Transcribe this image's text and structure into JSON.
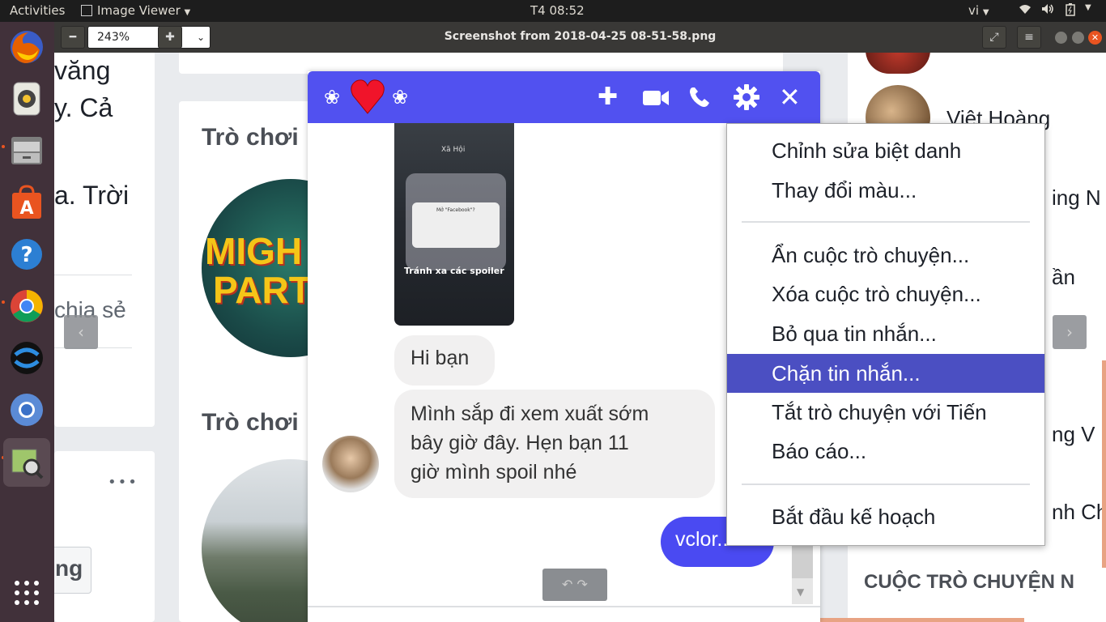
{
  "topbar": {
    "activities": "Activities",
    "app_name": "Image Viewer",
    "clock": "T4 08:52",
    "lang": "vi"
  },
  "launcher": {
    "apps": [
      "firefox-icon",
      "rhythmbox-icon",
      "files-icon",
      "software-center-icon",
      "help-icon",
      "chrome-icon",
      "sync-icon",
      "chromium-icon",
      "image-viewer-icon",
      "app-grid-icon"
    ]
  },
  "viewer": {
    "zoom": "243%",
    "title": "Screenshot from 2018-04-25 08-51-58.png"
  },
  "background_page": {
    "left_text_1": "văng",
    "left_text_2": "y. Cả",
    "left_text_3": "a. Trời",
    "share_text": "chia sẻ",
    "more_dots": "•••",
    "partial_button": "ng",
    "game_heading_1": "Trò chơi",
    "game_heading_2": "Trò chơi",
    "game_logo_line1": "MIGH",
    "game_logo_line2": "PART",
    "contacts": [
      "Việt Hoàng",
      "ing N",
      "ần",
      "ng V",
      "nh Ch"
    ],
    "conversations_heading": "CUỘC TRÒ CHUYỆN N"
  },
  "chat": {
    "shared_image_line1": "Xã Hội",
    "shared_image_line2": "Mở \"Facebook\"?",
    "shared_image_line3": "Tránh xa các spoiler",
    "messages": [
      {
        "text": "Hi bạn"
      },
      {
        "text_lines": [
          "Mình sắp đi xem xuất sớm",
          "bây giờ đây. Hẹn bạn 11",
          "giờ mình spoil nhé"
        ]
      }
    ],
    "outgoing": "vclor..."
  },
  "menu": {
    "items_group1": [
      "Chỉnh sửa biệt danh",
      "Thay đổi màu..."
    ],
    "items_group2": [
      "Ẩn cuộc trò chuyện...",
      "Xóa cuộc trò chuyện...",
      "Bỏ qua tin nhắn...",
      "Chặn tin nhắn...",
      "Tắt trò chuyện với Tiến",
      "Báo cáo..."
    ],
    "items_group3": [
      "Bắt đầu kế hoạch"
    ],
    "highlighted": "Chặn tin nhắn..."
  },
  "colors": {
    "messenger_blue": "#5151f0",
    "menu_highlight": "#4b4fc2",
    "ubuntu_orange": "#e95420"
  }
}
